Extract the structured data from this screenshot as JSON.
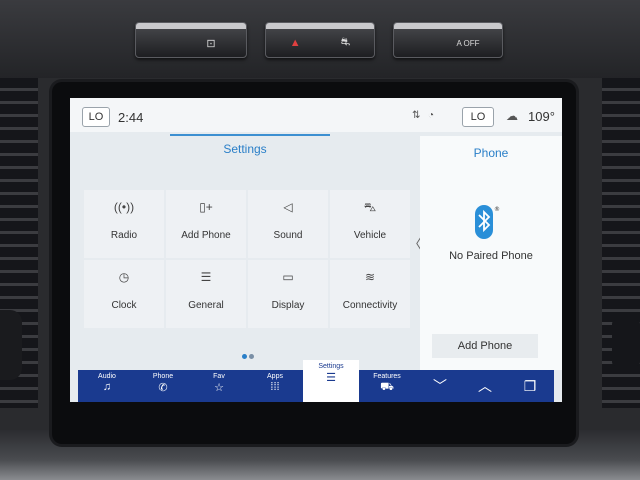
{
  "hardware": {
    "buttons": [
      {
        "name": "camera-button",
        "glyph": "▫⃞"
      },
      {
        "name": "hazard-button",
        "glyph": "▲"
      },
      {
        "name": "traction-button",
        "glyph": "⛐"
      },
      {
        "name": "auto-start-stop-button",
        "glyph": "OFF"
      }
    ]
  },
  "status": {
    "lo_left": "LO",
    "time": "2:44",
    "signal_icon": "⇅",
    "wifi_icon": "◔",
    "lo_right": "LO",
    "weather_icon": "☁",
    "temperature": "109°"
  },
  "settings": {
    "title": "Settings",
    "tiles": [
      {
        "label": "Radio",
        "icon": "((•))"
      },
      {
        "label": "Add Phone",
        "icon": "▯+"
      },
      {
        "label": "Sound",
        "icon": "◁"
      },
      {
        "label": "Vehicle",
        "icon": "⛍"
      },
      {
        "label": "Clock",
        "icon": "◷"
      },
      {
        "label": "General",
        "icon": "☰"
      },
      {
        "label": "Display",
        "icon": "▭"
      },
      {
        "label": "Connectivity",
        "icon": "≋"
      }
    ],
    "page_dots": 2,
    "active_dot": 0,
    "collapse_icon": "〈"
  },
  "phone": {
    "title": "Phone",
    "status_text": "No Paired Phone",
    "add_button": "Add Phone"
  },
  "nav": {
    "items": [
      {
        "label": "Audio",
        "icon": "♫"
      },
      {
        "label": "Phone",
        "icon": "✆"
      },
      {
        "label": "Fav",
        "icon": "☆"
      },
      {
        "label": "Apps",
        "icon": "⁞⁞⁞"
      },
      {
        "label": "Settings",
        "icon": "☰"
      },
      {
        "label": "Features",
        "icon": "⛟"
      }
    ],
    "active_index": 4,
    "right": [
      {
        "name": "chevron-down-icon",
        "glyph": "﹀"
      },
      {
        "name": "chevron-up-icon",
        "glyph": "︿"
      },
      {
        "name": "layers-icon",
        "glyph": "❐"
      }
    ]
  },
  "colors": {
    "accent": "#2a7fc8",
    "nav_bg": "#1a3a8f",
    "bluetooth": "#2a8fd8"
  }
}
